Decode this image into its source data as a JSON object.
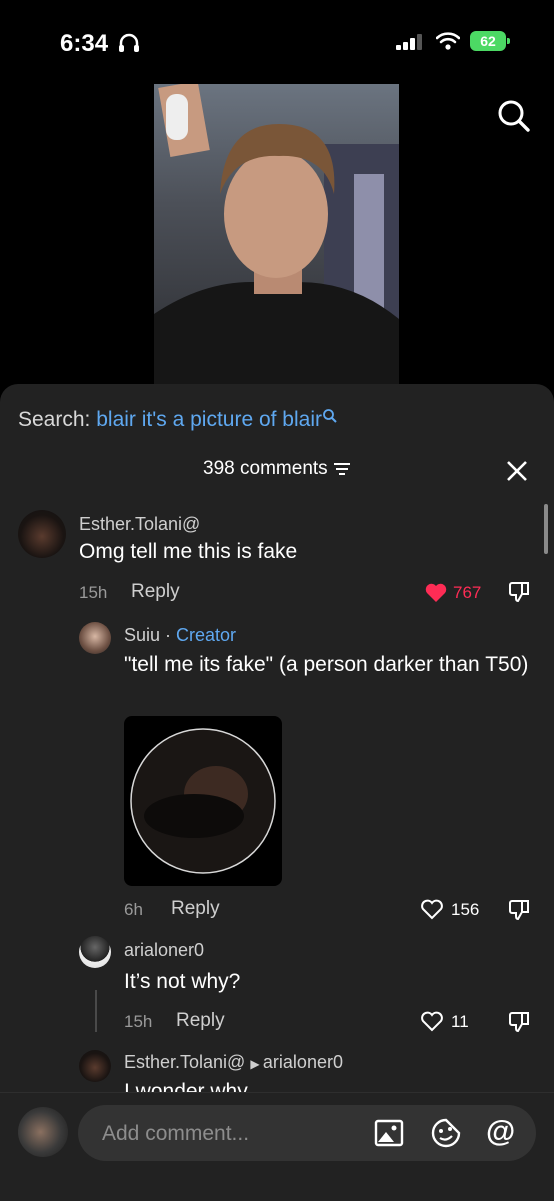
{
  "status": {
    "time": "6:34",
    "battery": "62"
  },
  "search": {
    "label": "Search:",
    "query": "blair it's a picture of blair"
  },
  "comments_header": {
    "count_text": "398 comments"
  },
  "comments": [
    {
      "user": "Esther.Tolani@",
      "text": "Omg tell me this is fake",
      "time": "15h",
      "reply": "Reply",
      "likes": "767"
    },
    {
      "user": "Suiu",
      "badge": "Creator",
      "text": "\"tell me its fake\" (a person darker than T50)",
      "time": "6h",
      "reply": "Reply",
      "likes": "156"
    },
    {
      "user": "arialoner0",
      "text": "It’s not why?",
      "time": "15h",
      "reply": "Reply",
      "likes": "11"
    },
    {
      "user": "Esther.Tolani@",
      "reply_to": "arialoner0",
      "text": "I wonder why"
    }
  ],
  "input": {
    "placeholder": "Add comment..."
  },
  "colors": {
    "accent_blue": "#5fa8f0",
    "like_red": "#fe2c55",
    "sheet_bg": "#222222"
  }
}
